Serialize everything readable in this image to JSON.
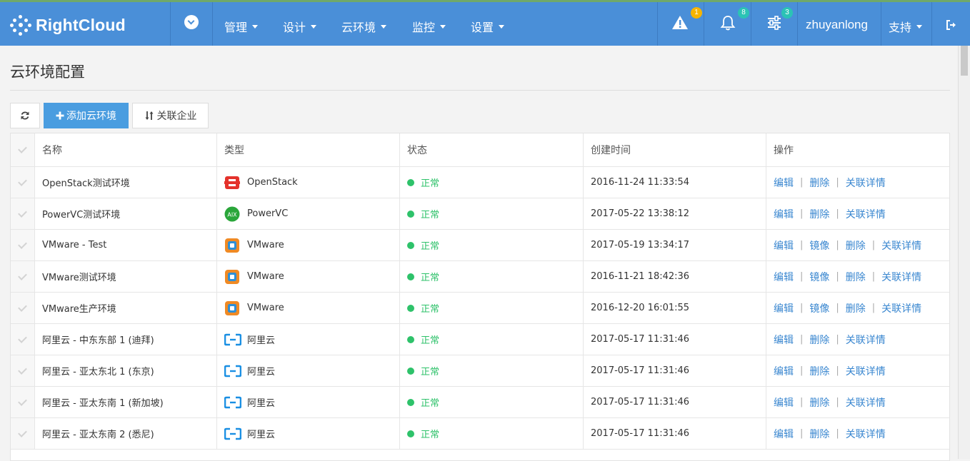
{
  "header": {
    "brand": "RightCloud",
    "menus": [
      {
        "label": "管理"
      },
      {
        "label": "设计"
      },
      {
        "label": "云环境"
      },
      {
        "label": "监控"
      },
      {
        "label": "设置"
      }
    ],
    "alert_badge": "1",
    "notification_badge": "8",
    "settings_badge": "3",
    "username": "zhuyanlong",
    "support_label": "支持",
    "colors": {
      "bar": "#4a8fd8",
      "alert_badge": "#f5b400",
      "notif_badge": "#2bc3b5"
    }
  },
  "page": {
    "title": "云环境配置"
  },
  "toolbar": {
    "add_label": "添加云环境",
    "link_label": "关联企业"
  },
  "table": {
    "headers": [
      "名称",
      "类型",
      "状态",
      "创建时间",
      "操作"
    ],
    "rows": [
      {
        "name": "OpenStack测试环境",
        "type": "OpenStack",
        "icon": "openstack-icon",
        "status": "正常",
        "created": "2016-11-24 11:33:54",
        "actions": [
          "编辑",
          "删除",
          "关联详情"
        ]
      },
      {
        "name": "PowerVC测试环境",
        "type": "PowerVC",
        "icon": "powervc-icon",
        "status": "正常",
        "created": "2017-05-22 13:38:12",
        "actions": [
          "编辑",
          "删除",
          "关联详情"
        ]
      },
      {
        "name": "VMware - Test",
        "type": "VMware",
        "icon": "vmware-icon",
        "status": "正常",
        "created": "2017-05-19 13:34:17",
        "actions": [
          "编辑",
          "镜像",
          "删除",
          "关联详情"
        ]
      },
      {
        "name": "VMware测试环境",
        "type": "VMware",
        "icon": "vmware-icon",
        "status": "正常",
        "created": "2016-11-21 18:42:36",
        "actions": [
          "编辑",
          "镜像",
          "删除",
          "关联详情"
        ]
      },
      {
        "name": "VMware生产环境",
        "type": "VMware",
        "icon": "vmware-icon",
        "status": "正常",
        "created": "2016-12-20 16:01:55",
        "actions": [
          "编辑",
          "镜像",
          "删除",
          "关联详情"
        ]
      },
      {
        "name": "阿里云 - 中东东部 1 (迪拜)",
        "type": "阿里云",
        "icon": "aliyun-icon",
        "status": "正常",
        "created": "2017-05-17 11:31:46",
        "actions": [
          "编辑",
          "删除",
          "关联详情"
        ]
      },
      {
        "name": "阿里云 - 亚太东北 1 (东京)",
        "type": "阿里云",
        "icon": "aliyun-icon",
        "status": "正常",
        "created": "2017-05-17 11:31:46",
        "actions": [
          "编辑",
          "删除",
          "关联详情"
        ]
      },
      {
        "name": "阿里云 - 亚太东南 1 (新加坡)",
        "type": "阿里云",
        "icon": "aliyun-icon",
        "status": "正常",
        "created": "2017-05-17 11:31:46",
        "actions": [
          "编辑",
          "删除",
          "关联详情"
        ]
      },
      {
        "name": "阿里云 - 亚太东南 2 (悉尼)",
        "type": "阿里云",
        "icon": "aliyun-icon",
        "status": "正常",
        "created": "2017-05-17 11:31:46",
        "actions": [
          "编辑",
          "删除",
          "关联详情"
        ]
      }
    ]
  }
}
